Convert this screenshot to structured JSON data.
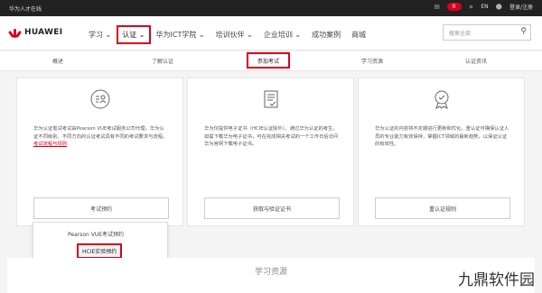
{
  "topbar": {
    "site_label": "华为人才在线",
    "badge_count": "0",
    "lang_label": "EN",
    "login_label": "登录/注册"
  },
  "brand": {
    "name": "HUAWEI"
  },
  "nav": {
    "items": [
      {
        "label": "学习",
        "has_caret": true
      },
      {
        "label": "认证",
        "has_caret": true,
        "active": true
      },
      {
        "label": "华为ICT学院",
        "has_caret": true
      },
      {
        "label": "培训伙伴",
        "has_caret": true
      },
      {
        "label": "企业培训",
        "has_caret": true
      },
      {
        "label": "成功案例",
        "has_caret": false
      },
      {
        "label": "商城",
        "has_caret": false
      }
    ],
    "search_placeholder": "搜索全部"
  },
  "subtabs": [
    {
      "label": "概述"
    },
    {
      "label": "了解认证"
    },
    {
      "label": "参加考试",
      "active": true
    },
    {
      "label": "学习资源"
    },
    {
      "label": "认证资讯"
    }
  ],
  "cards": [
    {
      "icon": "exam-person-icon",
      "desc_text": "华为认证笔试考试由Pearson VUE考试服务公司代理。华为认证不同级别、不同方向的认证考试具有不同的考试要求与流程。",
      "desc_link": "考试流程与规则",
      "button": "考试预约"
    },
    {
      "icon": "certificate-doc-icon",
      "desc_text": "华为仅提供电子证书（HCIE认证除外）。通过华为认证的考生，如需下载华为电子证书，可在完成相关考试的一个工作日后访问华为官网下载电子证书。",
      "button": "获取与验证证书"
    },
    {
      "icon": "award-badge-icon",
      "desc_text": "华为认证的内容将不定期进行更新和优化。重认证可确保认证人员的专业能力有效保持，掌握ICT领域的最新趋势，以保证认证的有效性。",
      "button": "重认证规则"
    }
  ],
  "dropdown": {
    "items": [
      "Pearson VUE考试预约",
      "HCIE实验预约"
    ]
  },
  "bottom": {
    "heading": "学习资源",
    "watermark": "九鼎软件园"
  }
}
